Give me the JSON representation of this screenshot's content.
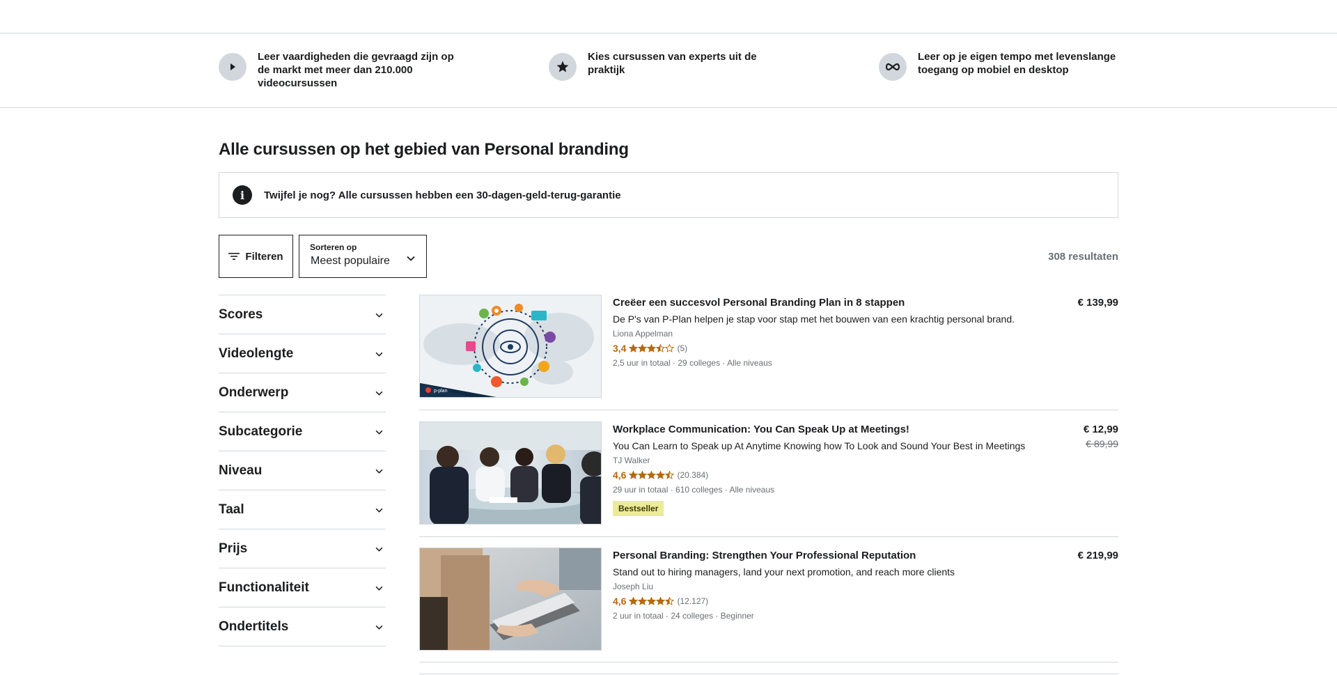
{
  "value_props": [
    {
      "icon": "play-icon",
      "text": "Leer vaardigheden die gevraagd zijn op de markt met meer dan 210.000 videocursussen"
    },
    {
      "icon": "star-icon",
      "text": "Kies cursussen van experts uit de praktijk"
    },
    {
      "icon": "infinity-icon",
      "text": "Leer op je eigen tempo met levenslange toegang op mobiel en desktop"
    }
  ],
  "page_title": "Alle cursussen op het gebied van Personal branding",
  "guarantee": "Twijfel je nog? Alle cursussen hebben een 30-dagen-geld-terug-garantie",
  "filter_label": "Filteren",
  "sort": {
    "label": "Sorteren op",
    "value": "Meest populaire"
  },
  "results_count": "308 resultaten",
  "filters": [
    "Scores",
    "Videolengte",
    "Onderwerp",
    "Subcategorie",
    "Niveau",
    "Taal",
    "Prijs",
    "Functionaliteit",
    "Ondertitels"
  ],
  "courses": [
    {
      "title": "Creëer een succesvol Personal Branding Plan in 8 stappen",
      "description": "De P's van P-Plan helpen je stap voor stap met het bouwen van een krachtig personal brand.",
      "author": "Liona Appelman",
      "rating": "3,4",
      "rating_value": 3.4,
      "reviews": "(5)",
      "meta": "2,5 uur in totaal · 29 colleges · Alle niveaus",
      "price": "€ 139,99",
      "thumb_text": "p-plan"
    },
    {
      "title": "Workplace Communication: You Can Speak Up at Meetings!",
      "description": "You Can Learn to Speak up At Anytime Knowing how To Look and Sound Your Best in Meetings",
      "author": "TJ Walker",
      "rating": "4,6",
      "rating_value": 4.6,
      "reviews": "(20.384)",
      "meta": "29 uur in totaal · 610 colleges · Alle niveaus",
      "badge": "Bestseller",
      "price": "€ 12,99",
      "old_price": "€ 89,99"
    },
    {
      "title": "Personal Branding: Strengthen Your Professional Reputation",
      "description": "Stand out to hiring managers, land your next promotion, and reach more clients",
      "author": "Joseph Liu",
      "rating": "4,6",
      "rating_value": 4.6,
      "reviews": "(12.127)",
      "meta": "2 uur in totaal · 24 colleges · Beginner",
      "price": "€ 219,99"
    }
  ],
  "colors": {
    "accent_rating": "#b4690e",
    "badge_bg": "#eceb98",
    "border": "#d1d7dc",
    "text": "#1c1d1f",
    "muted": "#6a6f73"
  }
}
